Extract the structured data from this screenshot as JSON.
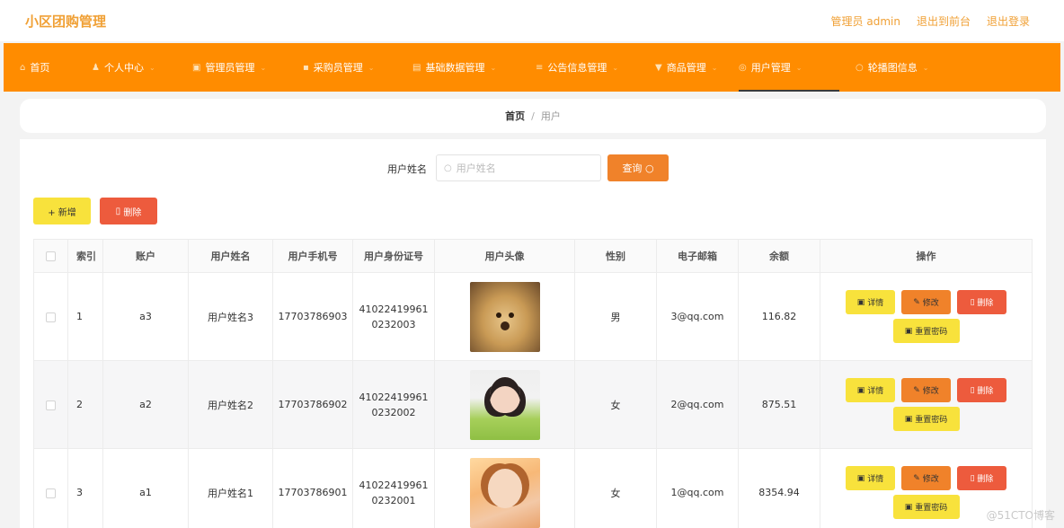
{
  "header": {
    "title": "小区团购管理",
    "links": [
      "管理员 admin",
      "退出到前台",
      "退出登录"
    ]
  },
  "nav": [
    {
      "label": "首页",
      "icon": "home-icon",
      "glyph": "⌂",
      "chevron": false
    },
    {
      "label": "个人中心",
      "icon": "user-icon",
      "glyph": "♟",
      "chevron": true
    },
    {
      "label": "管理员管理",
      "icon": "admin-icon",
      "glyph": "▣",
      "chevron": true
    },
    {
      "label": "采购员管理",
      "icon": "buyer-icon",
      "glyph": "▪",
      "chevron": true
    },
    {
      "label": "基础数据管理",
      "icon": "data-icon",
      "glyph": "▤",
      "chevron": true
    },
    {
      "label": "公告信息管理",
      "icon": "notice-icon",
      "glyph": "≡",
      "chevron": true
    },
    {
      "label": "商品管理",
      "icon": "goods-icon",
      "glyph": "▼",
      "chevron": true
    },
    {
      "label": "用户管理",
      "icon": "users-icon",
      "glyph": "◎",
      "chevron": true,
      "active": true
    },
    {
      "label": "轮播图信息",
      "icon": "carousel-icon",
      "glyph": "○",
      "chevron": true
    }
  ],
  "breadcrumb": {
    "home": "首页",
    "sep": "/",
    "current": "用户"
  },
  "search": {
    "label": "用户姓名",
    "placeholder": "用户姓名",
    "button": "查询"
  },
  "actions": {
    "add": "+ 新增",
    "delete": "删除"
  },
  "table": {
    "columns": [
      "",
      "索引",
      "账户",
      "用户姓名",
      "用户手机号",
      "用户身份证号",
      "用户头像",
      "性别",
      "电子邮箱",
      "余额",
      "操作"
    ],
    "rows": [
      {
        "index": "1",
        "account": "a3",
        "name": "用户姓名3",
        "phone": "17703786903",
        "id_line1": "41022419961",
        "id_line2": "0232003",
        "avatar": "puppy",
        "gender": "男",
        "email": "3@qq.com",
        "balance": "116.82"
      },
      {
        "index": "2",
        "account": "a2",
        "name": "用户姓名2",
        "phone": "17703786902",
        "id_line1": "41022419961",
        "id_line2": "0232002",
        "avatar": "girl",
        "gender": "女",
        "email": "2@qq.com",
        "balance": "875.51"
      },
      {
        "index": "3",
        "account": "a1",
        "name": "用户姓名1",
        "phone": "17703786901",
        "id_line1": "41022419961",
        "id_line2": "0232001",
        "avatar": "girl2",
        "gender": "女",
        "email": "1@qq.com",
        "balance": "8354.94"
      }
    ],
    "row_ops": {
      "detail": "详情",
      "edit": "修改",
      "delete": "删除",
      "reset": "重置密码"
    }
  },
  "watermark": "@51CTO博客"
}
